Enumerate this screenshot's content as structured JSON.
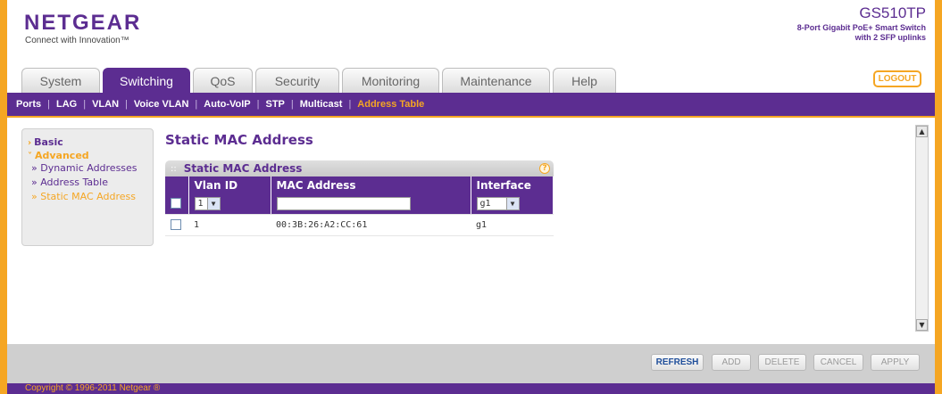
{
  "brand": {
    "logo": "NETGEAR",
    "tagline": "Connect with Innovation™",
    "model": "GS510TP",
    "model_desc_1": "8-Port Gigabit PoE+ Smart Switch",
    "model_desc_2": "with 2 SFP uplinks"
  },
  "tabs": [
    "System",
    "Switching",
    "QoS",
    "Security",
    "Monitoring",
    "Maintenance",
    "Help"
  ],
  "active_tab": "Switching",
  "logout_label": "LOGOUT",
  "subnav": [
    "Ports",
    "LAG",
    "VLAN",
    "Voice VLAN",
    "Auto-VoIP",
    "STP",
    "Multicast",
    "Address Table"
  ],
  "active_subnav": "Address Table",
  "sidebar": {
    "basic": "Basic",
    "advanced": "Advanced",
    "items": [
      "» Dynamic Addresses",
      "» Address Table",
      "» Static MAC Address"
    ]
  },
  "page_title": "Static MAC Address",
  "panel": {
    "title": "Static MAC Address",
    "help": "?",
    "columns": [
      "Vlan ID",
      "MAC Address",
      "Interface"
    ],
    "edit_row": {
      "vlan": "1",
      "mac": "",
      "interface": "g1"
    },
    "rows": [
      {
        "vlan": "1",
        "mac": "00:3B:26:A2:CC:61",
        "interface": "g1"
      }
    ]
  },
  "buttons": [
    "REFRESH",
    "ADD",
    "DELETE",
    "CANCEL",
    "APPLY"
  ],
  "footer": "Copyright © 1996-2011 Netgear ®",
  "colors": {
    "brand_purple": "#5c2d91",
    "accent_orange": "#f5a623"
  }
}
